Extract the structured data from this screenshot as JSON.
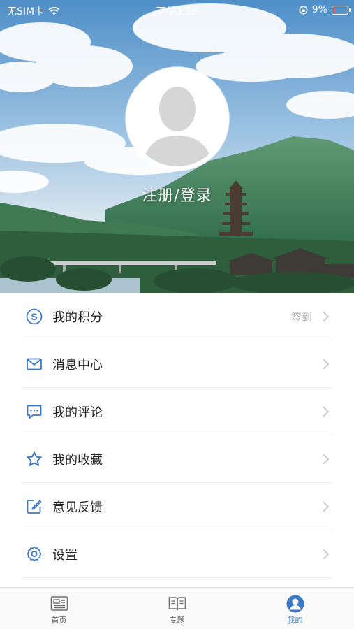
{
  "status_bar": {
    "carrier": "无SIM卡",
    "time": "下午3:58",
    "battery_percent": "9%",
    "battery_level": 0.09
  },
  "profile": {
    "login_label": "注册/登录",
    "avatar_icon": "default-avatar-icon"
  },
  "menu": [
    {
      "label": "我的积分",
      "icon": "points-icon",
      "extra": "签到"
    },
    {
      "label": "消息中心",
      "icon": "mail-icon",
      "extra": ""
    },
    {
      "label": "我的评论",
      "icon": "comment-icon",
      "extra": ""
    },
    {
      "label": "我的收藏",
      "icon": "star-icon",
      "extra": ""
    },
    {
      "label": "意见反馈",
      "icon": "edit-icon",
      "extra": ""
    },
    {
      "label": "设置",
      "icon": "settings-icon",
      "extra": ""
    }
  ],
  "tabbar": [
    {
      "label": "首页",
      "icon": "news-icon",
      "active": false
    },
    {
      "label": "专题",
      "icon": "book-icon",
      "active": false
    },
    {
      "label": "我的",
      "icon": "user-icon",
      "active": true
    }
  ],
  "colors": {
    "accent": "#3a78c9",
    "icon_blue": "#3a78c9",
    "text": "#222222",
    "muted": "#a8a8a8"
  }
}
